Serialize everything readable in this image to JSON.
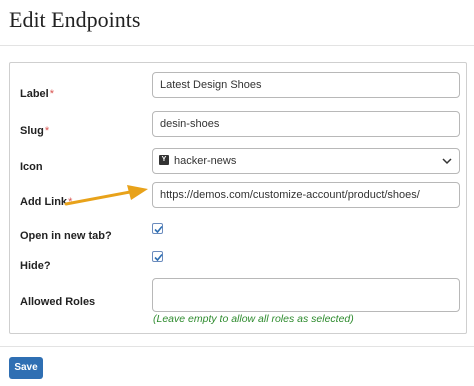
{
  "header": {
    "title": "Edit Endpoints"
  },
  "form": {
    "label": {
      "text": "Label",
      "required": "*",
      "value": "Latest Design Shoes"
    },
    "slug": {
      "text": "Slug",
      "required": "*",
      "value": "desin-shoes"
    },
    "icon": {
      "text": "Icon",
      "value": "hacker-news",
      "icon_glyph": "Y",
      "icon_name": "hacker-news-icon"
    },
    "add_link": {
      "text": "Add Link",
      "required": "*",
      "value": "https://demos.com/customize-account/product/shoes/"
    },
    "open_new_tab": {
      "text": "Open in new tab?",
      "checked": true
    },
    "hide": {
      "text": "Hide?",
      "checked": true
    },
    "allowed_roles": {
      "text": "Allowed Roles",
      "value": "",
      "hint": "(Leave empty to allow all roles as selected)"
    }
  },
  "footer": {
    "save_label": "Save"
  },
  "colors": {
    "accent": "#2f6fb3",
    "required": "#d9534f",
    "hint": "#2e8b2e",
    "arrow": "#e8a21a"
  }
}
